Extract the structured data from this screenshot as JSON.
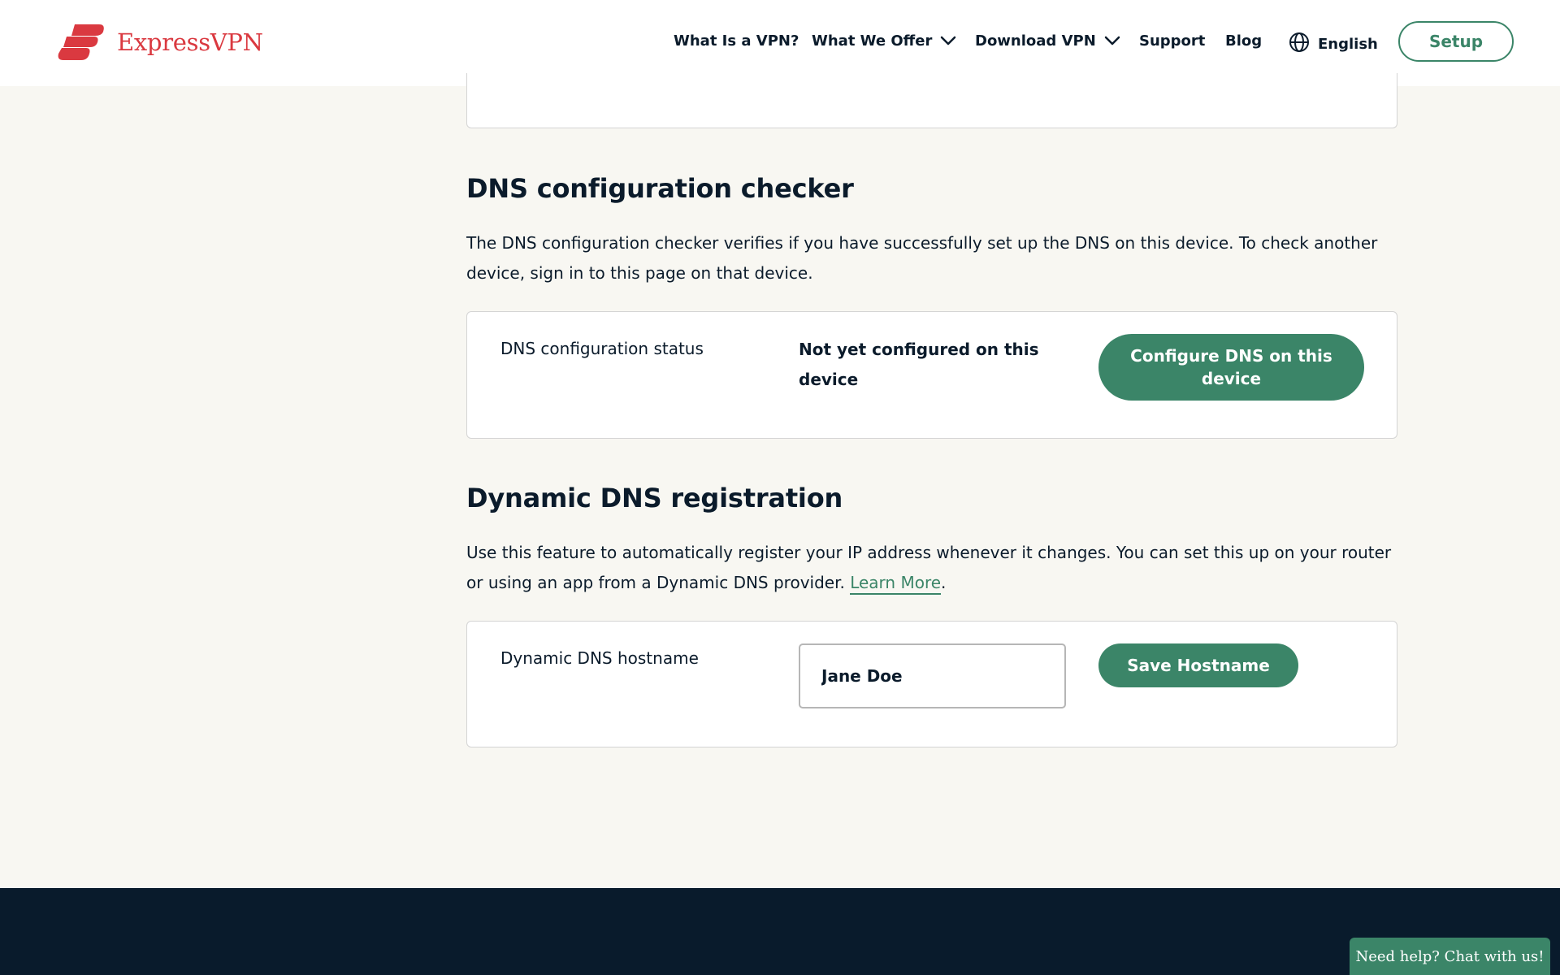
{
  "brand": {
    "name": "ExpressVPN",
    "logo_icon": "expressvpn-logo-icon",
    "color": "#da3940"
  },
  "nav": {
    "what_is_vpn": "What Is a VPN?",
    "what_we_offer": "What We Offer",
    "download_vpn": "Download VPN",
    "support": "Support",
    "blog": "Blog",
    "language": "English",
    "setup": "Setup"
  },
  "colors": {
    "accent": "#3b8568",
    "page_bg": "#f8f7f2",
    "text": "#0b1b2b",
    "footer_bg": "#091b2c"
  },
  "dns_checker": {
    "title": "DNS configuration checker",
    "description": "The DNS configuration checker verifies if you have successfully set up the DNS on this device. To check another device, sign in to this page on that device.",
    "status_label": "DNS configuration status",
    "status_value": "Not yet configured on this device",
    "configure_button": "Configure DNS on this device"
  },
  "dynamic_dns": {
    "title": "Dynamic DNS registration",
    "description": "Use this feature to automatically register your IP address whenever it changes. You can set this up on your router or using an app from a Dynamic DNS provider.",
    "learn_more": "Learn More",
    "period": ".",
    "hostname_label": "Dynamic DNS hostname",
    "hostname_value": "Jane Doe",
    "save_button": "Save Hostname"
  },
  "chat": {
    "label": "Need help? Chat with us!"
  }
}
